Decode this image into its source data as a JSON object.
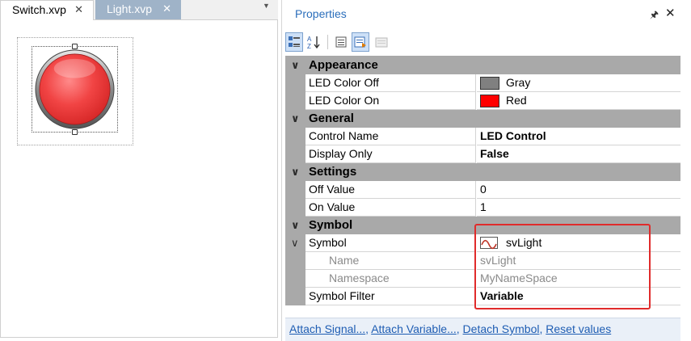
{
  "tabs": [
    {
      "label": "Switch.xvp",
      "active": true
    },
    {
      "label": "Light.xvp",
      "active": false
    }
  ],
  "tab_close_glyph": "✕",
  "led_color": "#f14444",
  "properties": {
    "title": "Properties",
    "categories": {
      "appearance": "Appearance",
      "general": "General",
      "settings": "Settings",
      "symbol": "Symbol"
    },
    "rows": {
      "led_color_off": {
        "name": "LED Color Off",
        "value": "Gray",
        "swatch": "#808080"
      },
      "led_color_on": {
        "name": "LED Color On",
        "value": "Red",
        "swatch": "#ff0000"
      },
      "control_name": {
        "name": "Control Name",
        "value": "LED Control"
      },
      "display_only": {
        "name": "Display Only",
        "value": "False"
      },
      "off_value": {
        "name": "Off Value",
        "value": "0"
      },
      "on_value": {
        "name": "On Value",
        "value": "1"
      },
      "symbol": {
        "name": "Symbol",
        "value": "svLight"
      },
      "symbol_name": {
        "name": "Name",
        "value": "svLight"
      },
      "symbol_namespace": {
        "name": "Namespace",
        "value": "MyNameSpace"
      },
      "symbol_filter": {
        "name": "Symbol Filter",
        "value": "Variable"
      }
    },
    "footer": {
      "attach_signal": "Attach Signal...",
      "attach_variable": "Attach Variable...",
      "detach_symbol": "Detach Symbol",
      "reset_values": "Reset values",
      "separator": ","
    }
  },
  "icons": [
    "categorized-icon",
    "alphabetical-icon",
    "property-pages-icon",
    "events-icon",
    "disabled-icon",
    "pin-icon",
    "close-icon",
    "chevron-down-icon",
    "sine-wave-icon",
    "dropdown-arrow-icon"
  ],
  "colors": {
    "accent": "#2a6ebb",
    "highlight": "#e02b2b",
    "category_bg": "#a9a9a9",
    "inactive_tab": "#9fb3c8"
  }
}
